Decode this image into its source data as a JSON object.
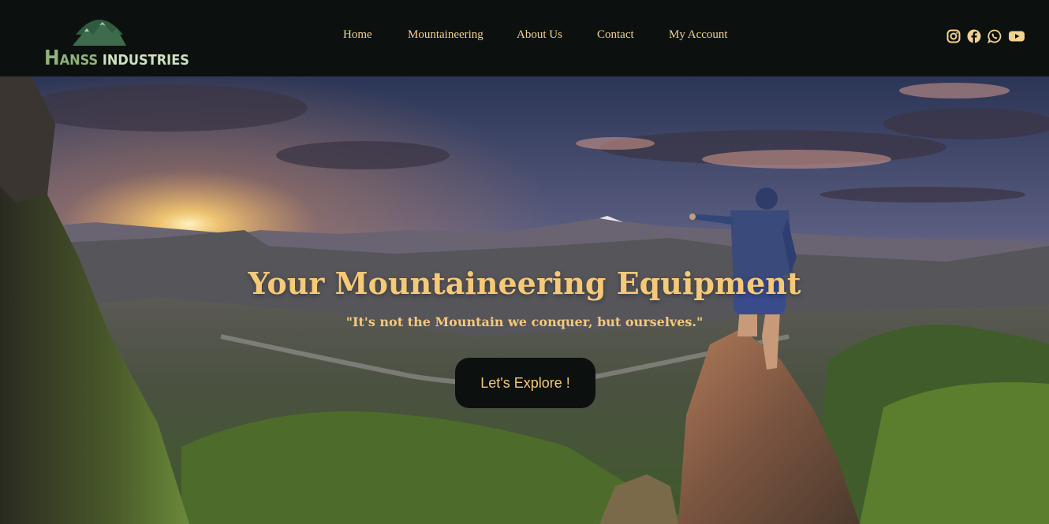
{
  "brand": {
    "logo_prefix": "H",
    "logo_middle": "ANSS",
    "logo_suffix": "INDUSTRIES",
    "accent": "#8fb37a"
  },
  "nav": {
    "items": [
      {
        "label": "Home"
      },
      {
        "label": "Mountaineering"
      },
      {
        "label": "About Us"
      },
      {
        "label": "Contact"
      },
      {
        "label": "My Account"
      }
    ],
    "color": "#f3d28f"
  },
  "social": {
    "icons": [
      "instagram-icon",
      "facebook-icon",
      "whatsapp-icon",
      "youtube-icon"
    ]
  },
  "hero": {
    "headline": "Your Mountaineering Equipment",
    "quote": "\"It's not the Mountain we conquer, but ourselves.\"",
    "cta_label": "Let's Explore !",
    "text_color": "#f5c978"
  },
  "colors": {
    "header_bg": "#0c1110",
    "button_bg": "#0c1110"
  }
}
